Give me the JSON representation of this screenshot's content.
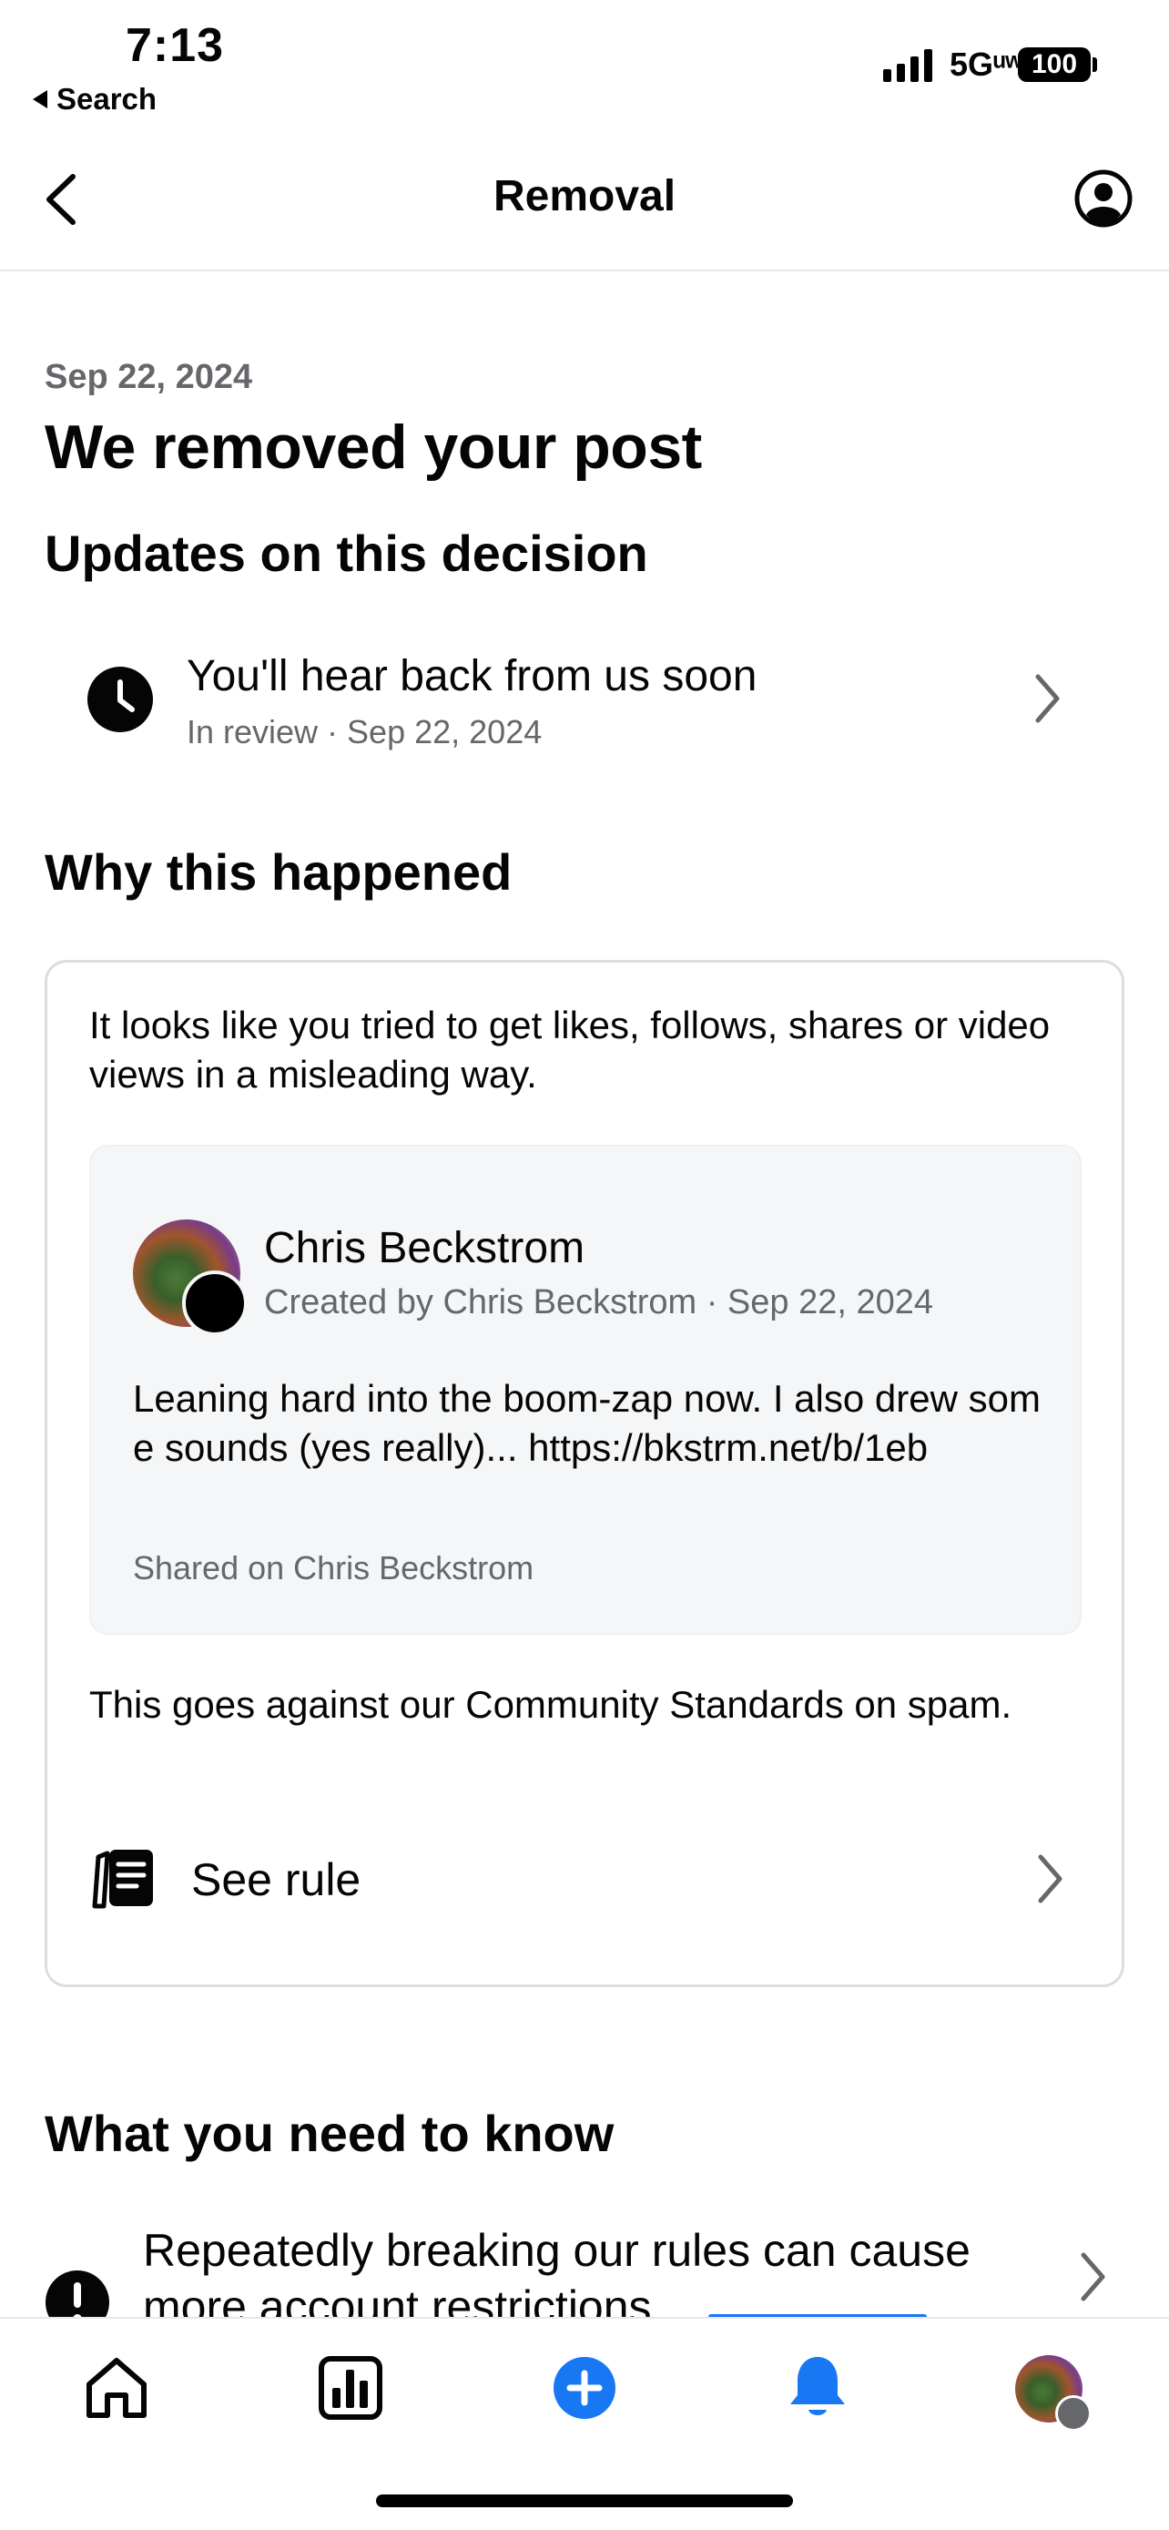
{
  "status_bar": {
    "time": "7:13",
    "back_app": "Search",
    "network": "5Gᵘʷ",
    "battery": "100"
  },
  "nav": {
    "title": "Removal"
  },
  "notice": {
    "date": "Sep 22, 2024",
    "heading": "We removed your post"
  },
  "updates": {
    "heading": "Updates on this decision",
    "item_title": "You'll hear back from us soon",
    "item_subtitle": "In review · Sep 22, 2024"
  },
  "why": {
    "heading": "Why this happened",
    "description": "It looks like you tried to get likes, follows, shares or video views in a misleading way.",
    "post": {
      "author": "Chris Beckstrom",
      "meta": "Created by Chris Beckstrom · Sep 22, 2024",
      "text": "Leaning hard into the boom-zap now. I also drew some sounds (yes really)... https://bkstrm.net/b/1eb",
      "shared_on": "Shared on Chris Beckstrom"
    },
    "against": "This goes against our Community Standards on spam.",
    "see_rule": "See rule"
  },
  "need_to_know": {
    "heading": "What you need to know",
    "item": "Repeatedly breaking our rules can cause more account restrictions."
  },
  "tabs": [
    "home",
    "insights",
    "create",
    "notifications",
    "profile"
  ],
  "colors": {
    "accent": "#1877f2",
    "secondary_text": "#65676b"
  }
}
